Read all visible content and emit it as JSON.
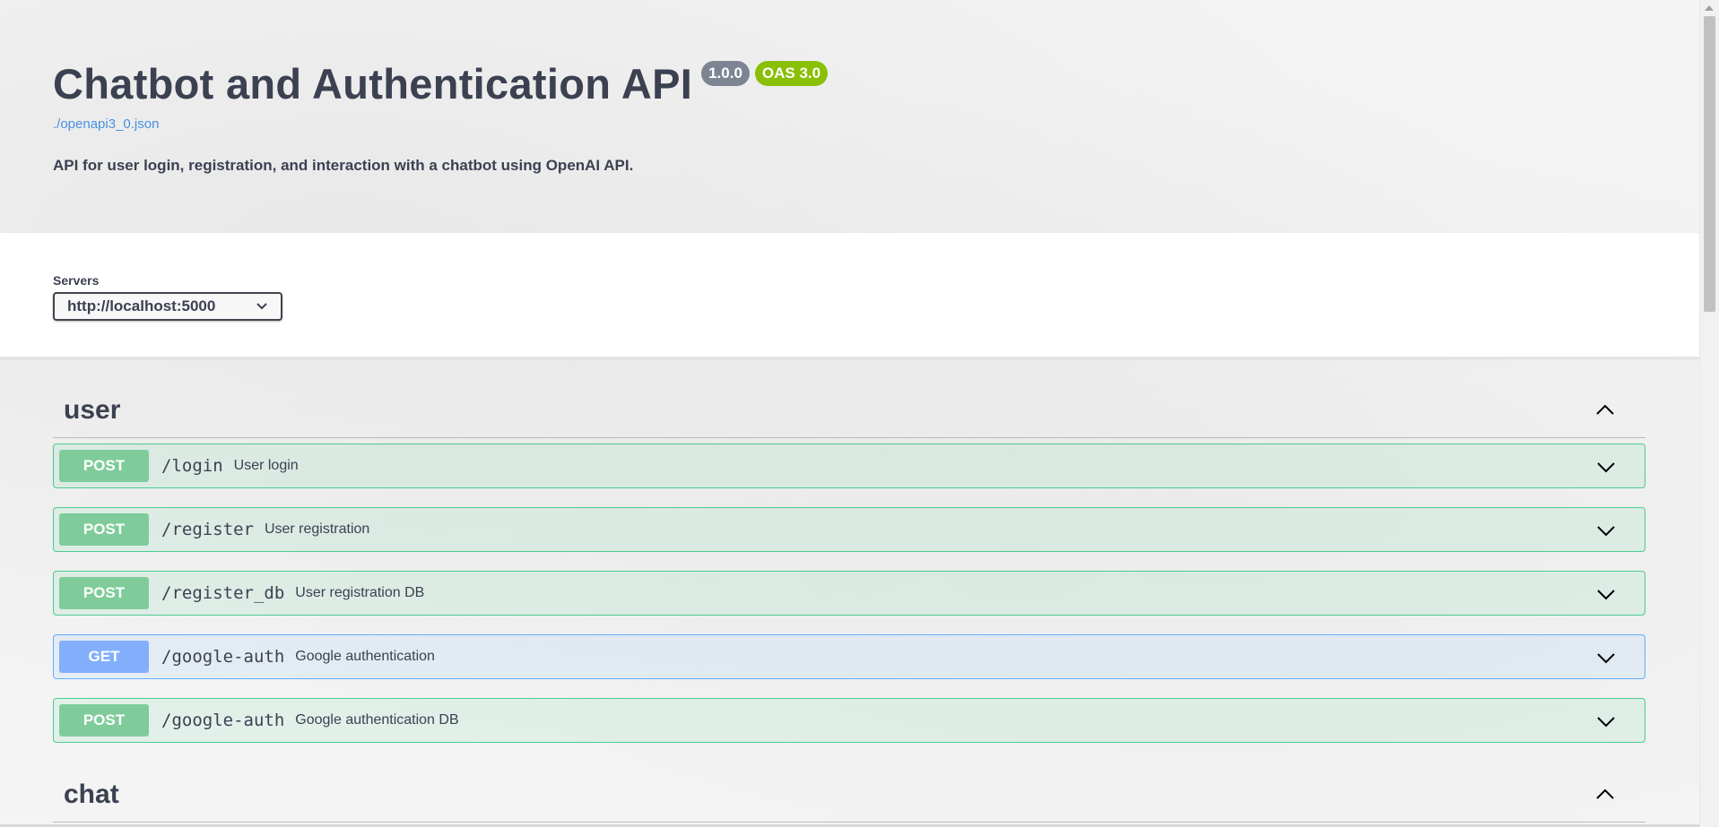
{
  "info": {
    "title": "Chatbot and Authentication API",
    "version": "1.0.0",
    "oas": "OAS 3.0",
    "spec_link": "./openapi3_0.json",
    "description": "API for user login, registration, and interaction with a chatbot using OpenAI API."
  },
  "servers": {
    "label": "Servers",
    "selected": "http://localhost:5000"
  },
  "tags": [
    {
      "name": "user",
      "operations": [
        {
          "method": "POST",
          "path": "/login",
          "summary": "User login"
        },
        {
          "method": "POST",
          "path": "/register",
          "summary": "User registration"
        },
        {
          "method": "POST",
          "path": "/register_db",
          "summary": "User registration DB"
        },
        {
          "method": "GET",
          "path": "/google-auth",
          "summary": "Google authentication"
        },
        {
          "method": "POST",
          "path": "/google-auth",
          "summary": "Google authentication DB"
        }
      ]
    },
    {
      "name": "chat",
      "operations": []
    }
  ],
  "colors": {
    "post": "#49cc90",
    "get": "#61affe",
    "version_badge": "#7d8492",
    "oas_badge": "#89bf04",
    "link": "#4990e2"
  },
  "icons": {
    "collapse": "chevron-up-icon",
    "expand": "chevron-down-icon",
    "select_arrow": "chevron-down-icon"
  }
}
